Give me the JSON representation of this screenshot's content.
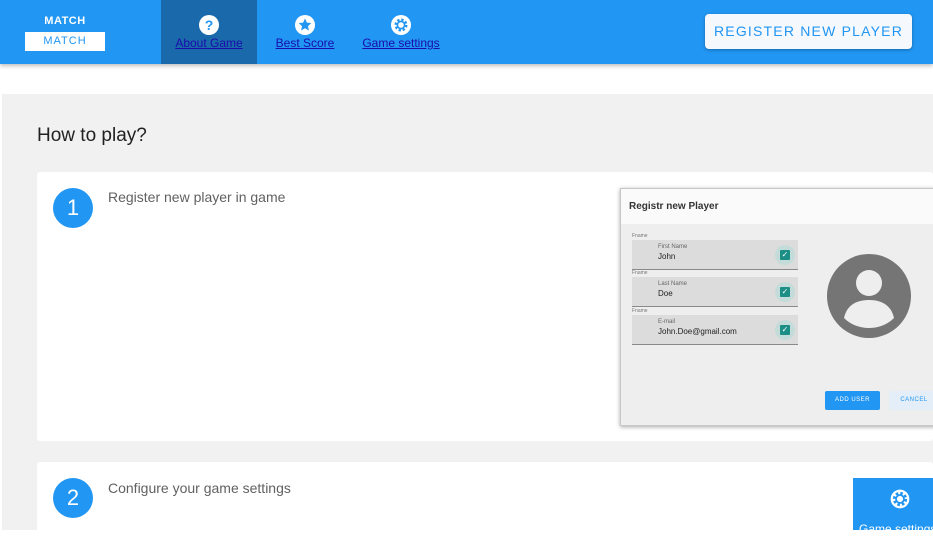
{
  "header": {
    "logo_top": "MATCH",
    "logo_bottom": "MATCH",
    "nav": [
      {
        "label": "About Game",
        "icon": "help-icon",
        "active": true
      },
      {
        "label": "Best Score",
        "icon": "star-icon",
        "active": false
      },
      {
        "label": "Game settings",
        "icon": "gear-icon",
        "active": false
      }
    ],
    "register_button": "REGISTER NEW PLAYER"
  },
  "main": {
    "title": "How to play?",
    "steps": [
      {
        "number": "1",
        "text": "Register new player in game"
      },
      {
        "number": "2",
        "text": "Configure your game settings"
      }
    ]
  },
  "preview": {
    "title": "Registr new Player",
    "fields": [
      {
        "hint": "Fname",
        "label": "First Name",
        "value": "John"
      },
      {
        "hint": "Fname",
        "label": "Last Name",
        "value": "Doe"
      },
      {
        "hint": "Fname",
        "label": "E-mail",
        "value": "John.Doe@gmail.com"
      }
    ],
    "add_button": "ADD USER",
    "cancel_button": "CANCEL"
  },
  "fab": {
    "icon": "gear-icon",
    "label": "Game settings"
  },
  "colors": {
    "primary": "#2196f3",
    "active_nav": "#1a6aab",
    "check": "#1b8e85"
  }
}
